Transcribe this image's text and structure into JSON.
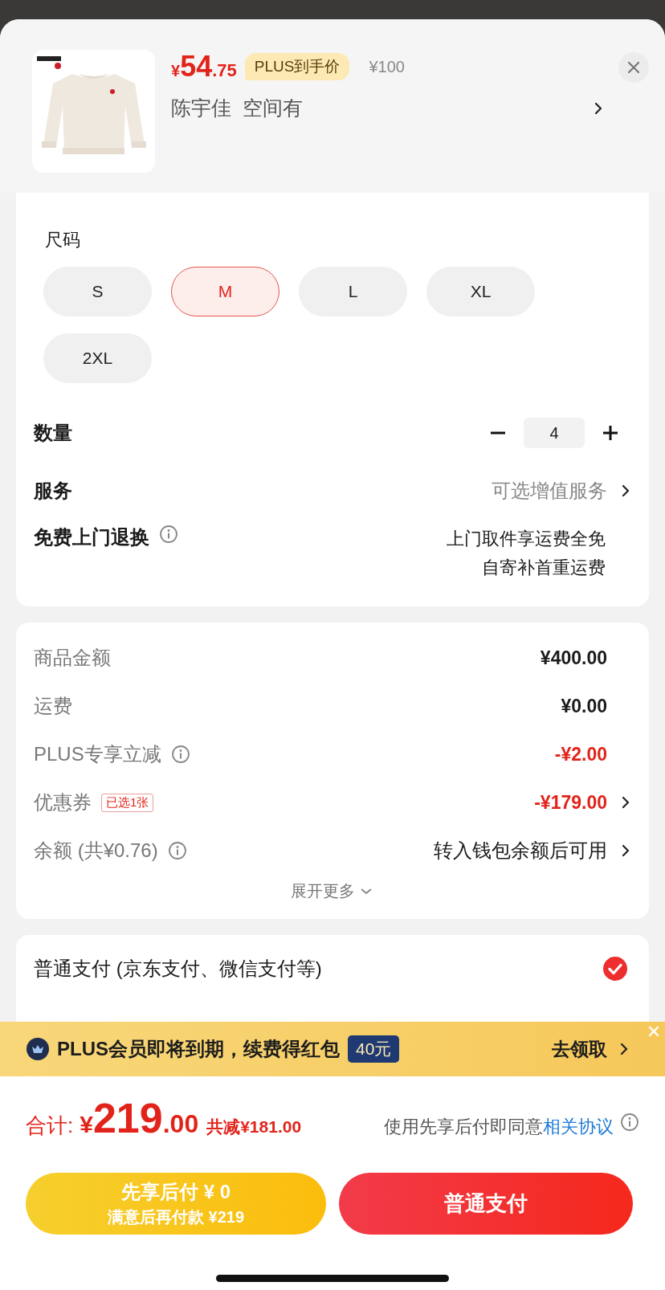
{
  "product": {
    "price": {
      "symbol": "¥",
      "integer": "54",
      "decimal": ".75"
    },
    "price_tag": "PLUS到手价",
    "original_price": "¥100",
    "variant": "陈宇佳  空间有"
  },
  "size_section": {
    "title": "尺码",
    "sizes": [
      {
        "label": "S",
        "selected": false
      },
      {
        "label": "M",
        "selected": true
      },
      {
        "label": "L",
        "selected": false
      },
      {
        "label": "XL",
        "selected": false
      },
      {
        "label": "2XL",
        "selected": false
      }
    ]
  },
  "quantity": {
    "label": "数量",
    "value": "4"
  },
  "service": {
    "label": "服务",
    "value": "可选增值服务"
  },
  "return_service": {
    "label": "免费上门退换",
    "lines": [
      "上门取件享运费全免",
      "自寄补首重运费"
    ]
  },
  "summary": {
    "rows": [
      {
        "label": "商品金额",
        "value": "¥400.00",
        "kind": "plain"
      },
      {
        "label": "运费",
        "value": "¥0.00",
        "kind": "plain"
      },
      {
        "label": "PLUS专享立减",
        "value": "-¥2.00",
        "kind": "discount",
        "info": true
      },
      {
        "label": "优惠券",
        "tag": "已选1张",
        "value": "-¥179.00",
        "kind": "discount",
        "arrow": true
      },
      {
        "label": "余额 (共¥0.76)",
        "value": "转入钱包余额后可用",
        "kind": "plain",
        "info": true,
        "arrow": true
      }
    ],
    "expand": "展开更多"
  },
  "payment": {
    "label": "普通支付 (京东支付、微信支付等)",
    "selected": true
  },
  "banner": {
    "text": "PLUS会员即将到期，续费得红包",
    "badge": "40元",
    "action": "去领取"
  },
  "total": {
    "label": "合计:",
    "symbol": "¥",
    "integer": "219",
    "decimal": ".00",
    "saved": "共减¥181.00",
    "agreement": "使用先享后付即同意",
    "agreement_link": "相关协议"
  },
  "buttons": [
    {
      "kind": "later",
      "title": "先享后付 ¥ 0",
      "subtitle": "满意后再付款 ¥219"
    },
    {
      "kind": "normal",
      "title": "普通支付"
    }
  ]
}
